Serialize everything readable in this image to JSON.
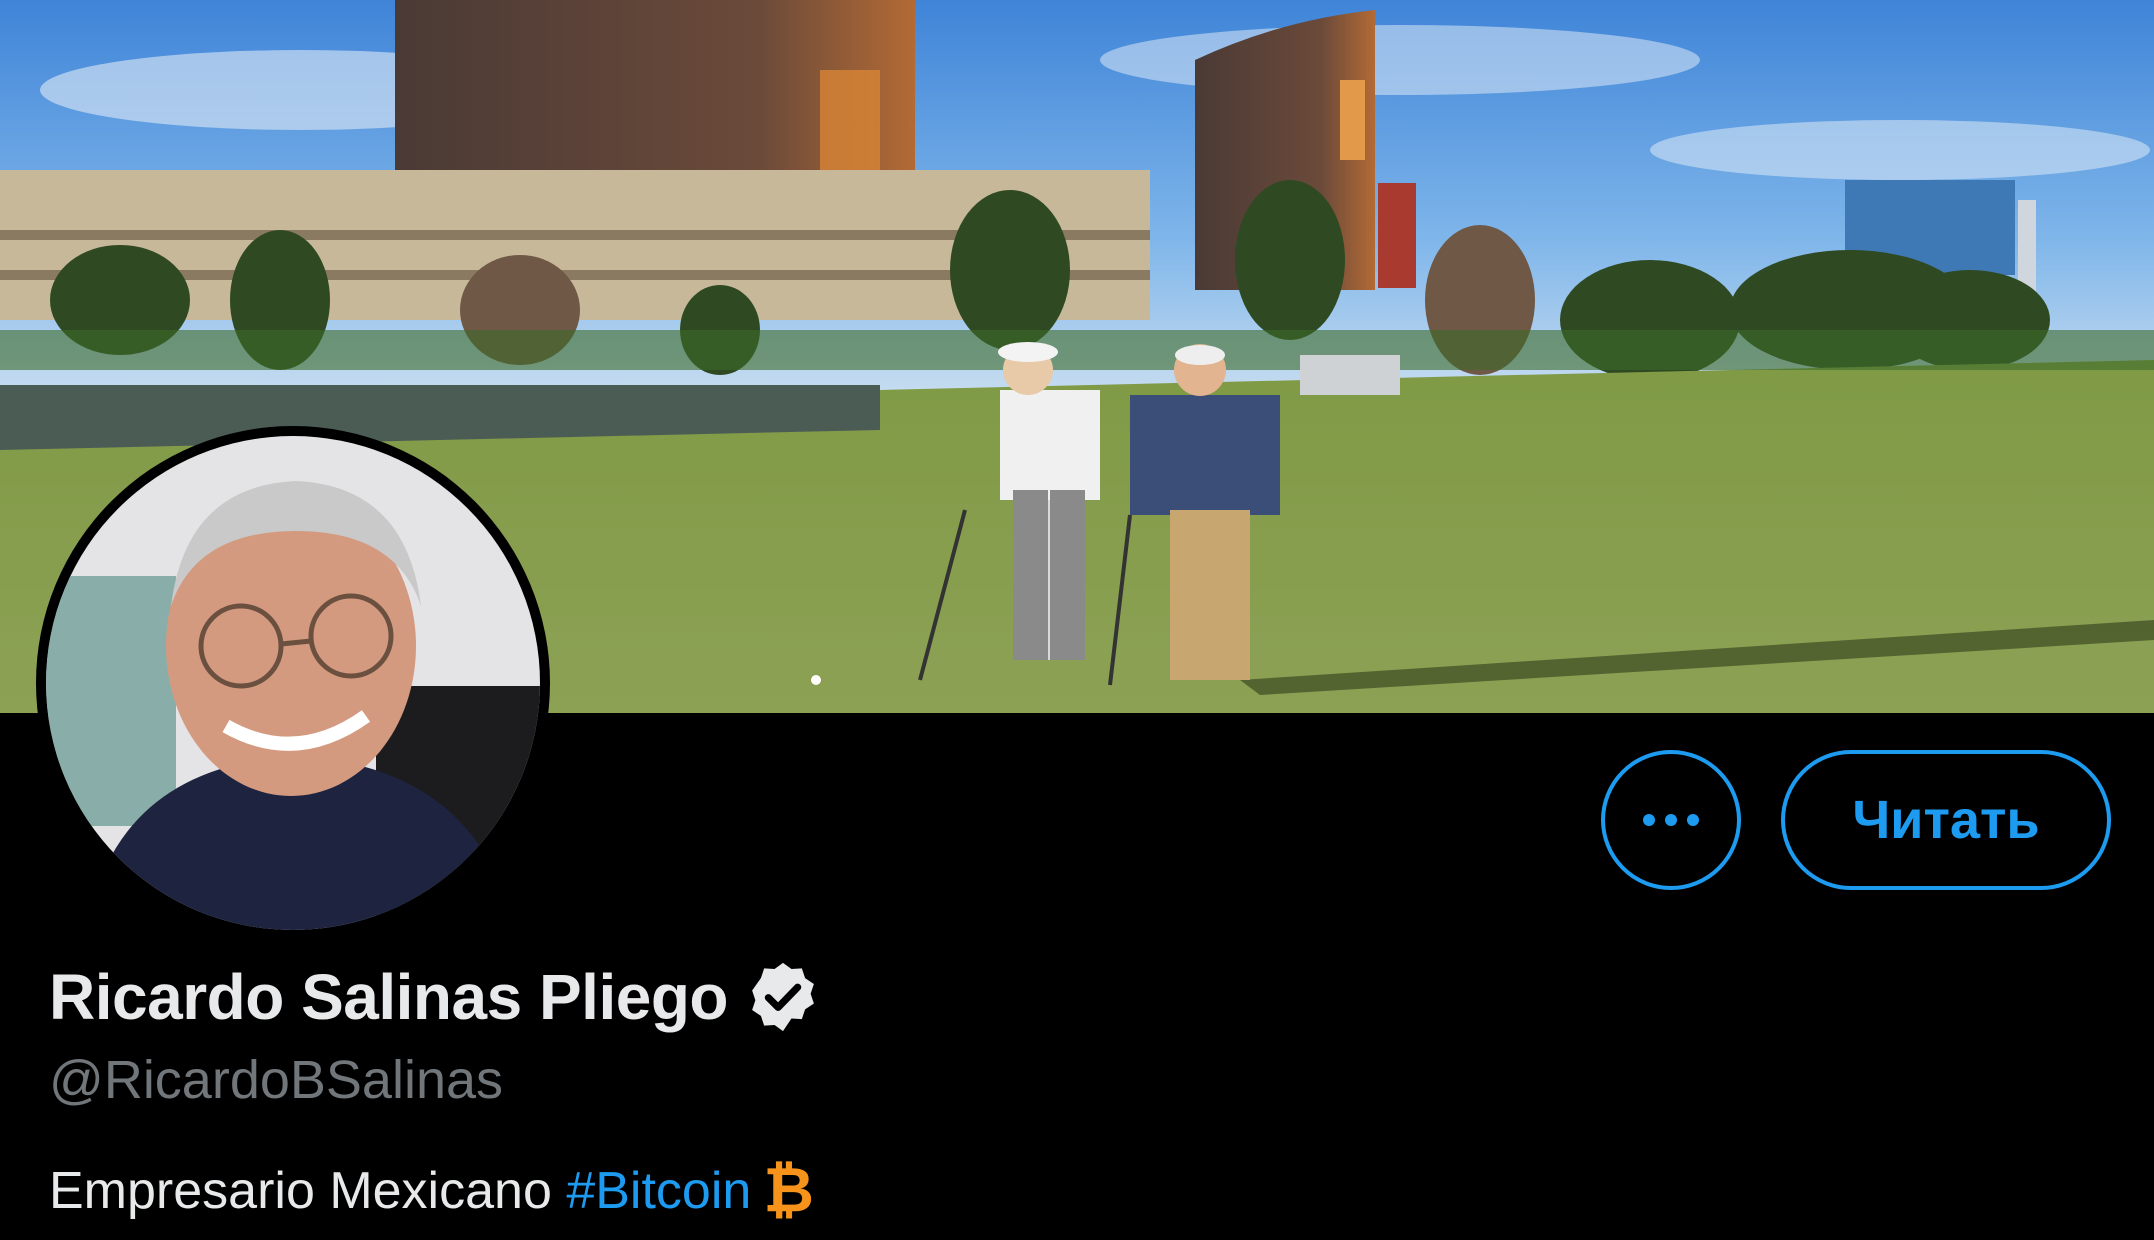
{
  "profile": {
    "display_name": "Ricardo Salinas Pliego",
    "handle": "@RicardoBSalinas",
    "bio_text": "Empresario Mexicano ",
    "bio_hashtag": "#Bitcoin",
    "bio_emoji": "₿",
    "verified": true
  },
  "actions": {
    "follow_label": "Читать",
    "more_icon": "more-options-icon"
  },
  "colors": {
    "accent": "#1d9bf0",
    "bitcoin": "#f7931a",
    "text_primary": "#e7e9ea",
    "text_secondary": "#71767b",
    "background": "#000000"
  }
}
